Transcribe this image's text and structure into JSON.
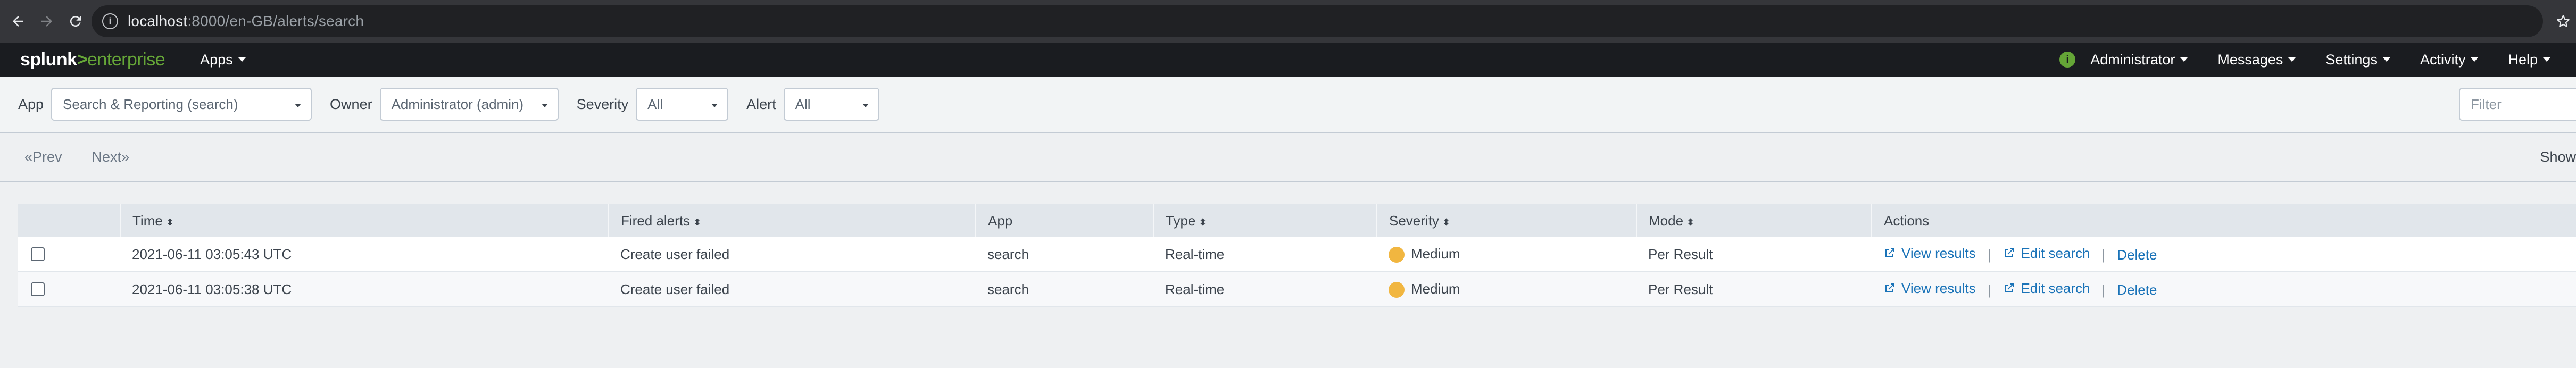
{
  "browser": {
    "url_host": "localhost",
    "url_path": ":8000/en-GB/alerts/search"
  },
  "splunkbar": {
    "logo_left": "splunk",
    "logo_gt": ">",
    "logo_right": "enterprise",
    "apps_label": "Apps",
    "user_label": "Administrator",
    "messages_label": "Messages",
    "settings_label": "Settings",
    "activity_label": "Activity",
    "help_label": "Help",
    "health_icon": "i"
  },
  "filters": {
    "app_label": "App",
    "app_value": "Search & Reporting (search)",
    "owner_label": "Owner",
    "owner_value": "Administrator (admin)",
    "severity_label": "Severity",
    "severity_value": "All",
    "alert_label": "Alert",
    "alert_value": "All",
    "filter_placeholder": "Filter"
  },
  "pager": {
    "prev": "«Prev",
    "next": "Next»",
    "show": "Show"
  },
  "table": {
    "columns": [
      "Time",
      "Fired alerts",
      "App",
      "Type",
      "Severity",
      "Mode",
      "Actions"
    ],
    "rows": [
      {
        "time": "2021-06-11 03:05:43 UTC",
        "fired_alert": "Create user failed",
        "app": "search",
        "type": "Real-time",
        "severity": "Medium",
        "mode": "Per Result"
      },
      {
        "time": "2021-06-11 03:05:38 UTC",
        "fired_alert": "Create user failed",
        "app": "search",
        "type": "Real-time",
        "severity": "Medium",
        "mode": "Per Result"
      }
    ],
    "actions": {
      "view_results": "View results",
      "edit_search": "Edit search",
      "delete": "Delete",
      "separator": "|"
    },
    "severity_color": "#f1b640",
    "link_color": "#1a73b8"
  }
}
